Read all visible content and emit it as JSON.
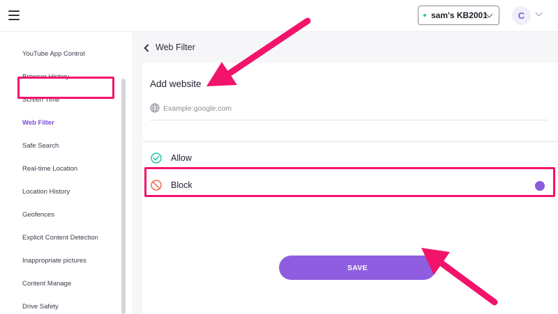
{
  "header": {
    "device_name": "sam's KB2001",
    "avatar_letter": "C"
  },
  "sidebar": {
    "items": [
      {
        "label": "YouTube App Control"
      },
      {
        "label": "Browser History"
      },
      {
        "label": "Screen Time"
      },
      {
        "label": "Web Filter",
        "active": true
      },
      {
        "label": "Safe Search"
      },
      {
        "label": "Real-time Location"
      },
      {
        "label": "Location History"
      },
      {
        "label": "Geofences"
      },
      {
        "label": "Explicit Content Detection"
      },
      {
        "label": "Inappropriate pictures"
      },
      {
        "label": "Content Manage"
      },
      {
        "label": "Drive Safety"
      }
    ]
  },
  "main": {
    "back_label": "Web Filter",
    "add_title": "Add website",
    "url_placeholder": "Example:google.com",
    "options": [
      {
        "label": "Allow",
        "selected": false
      },
      {
        "label": "Block",
        "selected": true
      }
    ],
    "save_label": "SAVE"
  },
  "icons": {
    "menu": "hamburger-icon",
    "globe": "globe-icon",
    "allow": "check-circle-icon",
    "block": "block-circle-icon"
  },
  "colors": {
    "accent": "#8f5ee0",
    "highlight": "#f2136b",
    "allow": "#22c7a0",
    "block": "#f06a4a"
  }
}
